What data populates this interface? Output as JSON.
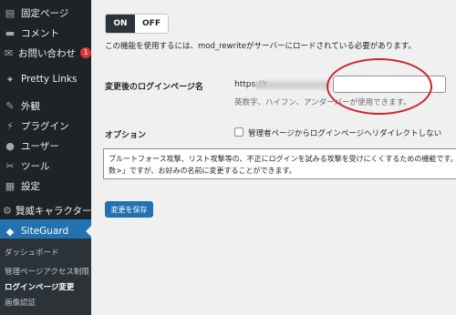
{
  "sidebar": {
    "items": [
      {
        "label": "固定ページ",
        "icon": "page-icon",
        "glyph": "▤"
      },
      {
        "label": "コメント",
        "icon": "comment-icon",
        "glyph": "▬"
      },
      {
        "label": "お問い合わせ",
        "icon": "mail-icon",
        "glyph": "✉",
        "badge": "1"
      },
      {
        "label": "Pretty Links",
        "icon": "star-icon",
        "glyph": "✦"
      },
      {
        "label": "外観",
        "icon": "brush-icon",
        "glyph": "✎"
      },
      {
        "label": "プラグイン",
        "icon": "plugin-icon",
        "glyph": "⚡"
      },
      {
        "label": "ユーザー",
        "icon": "user-icon",
        "glyph": "●"
      },
      {
        "label": "ツール",
        "icon": "wrench-icon",
        "glyph": "✂"
      },
      {
        "label": "設定",
        "icon": "settings-icon",
        "glyph": "▦"
      },
      {
        "label": "賢威キャラクター",
        "icon": "gear-icon",
        "glyph": "⚙"
      },
      {
        "label": "SiteGuard",
        "icon": "siteguard-icon",
        "glyph": "◆"
      }
    ],
    "submenu": [
      "ダッシュボード",
      "管理ページアクセス制限",
      "ログインページ変更",
      "画像認証"
    ]
  },
  "toggle": {
    "on": "ON",
    "off": "OFF"
  },
  "notice": "この機能を使用するには、mod_rewriteがサーバーにロードされている必要があります。",
  "login_page": {
    "label": "変更後のログインページ名",
    "prefix": "https://r",
    "hint": "英数字、ハイフン、アンダーバーが使用できます。"
  },
  "option": {
    "label": "オプション",
    "checkbox_label": "管理者ページからログインページへリダイレクトしない"
  },
  "description": {
    "line1": "ブルートフォース攻撃、リスト攻撃等の、不正にログインを試みる攻撃を受けにくくするための機能です。ロ",
    "line2": "数>」ですが、お好みの名前に変更することができます。"
  },
  "save_button": "変更を保存",
  "colors": {
    "sidebar": "#1d2327",
    "active": "#2271b1",
    "annotation": "#d0232b",
    "badge": "#d63638"
  }
}
